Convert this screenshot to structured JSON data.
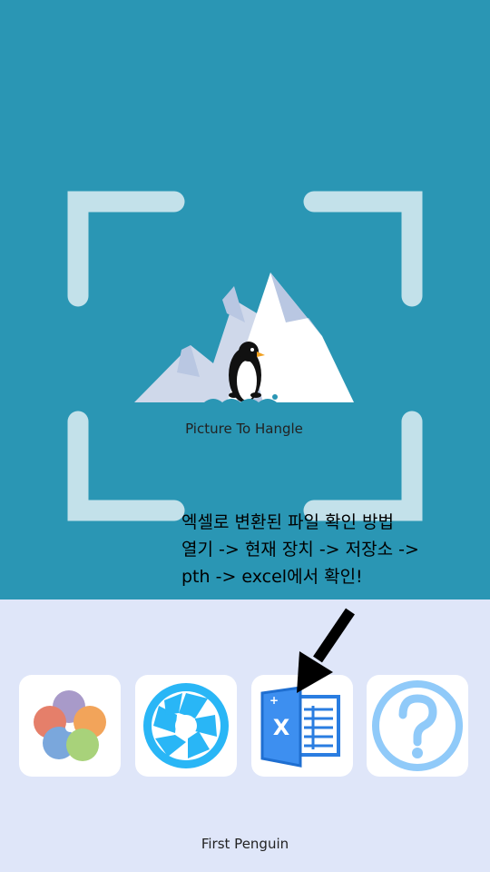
{
  "logo": {
    "caption": "Picture To Hangle"
  },
  "instructions": {
    "lines": [
      "엑셀로 변환된 파일 확인 방법",
      "열기 -> 현재 장치 -> 저장소 ->",
      "pth -> excel에서 확인!"
    ]
  },
  "tiles": [
    {
      "icon": "gallery-flower-icon"
    },
    {
      "icon": "camera-aperture-icon"
    },
    {
      "icon": "excel-icon"
    },
    {
      "icon": "help-question-icon"
    }
  ],
  "footer": {
    "text": "First Penguin"
  },
  "colors": {
    "hero_bg": "#2a96b4",
    "bottom_bg": "#dfe6f9",
    "frame": "#c3e1ea"
  }
}
